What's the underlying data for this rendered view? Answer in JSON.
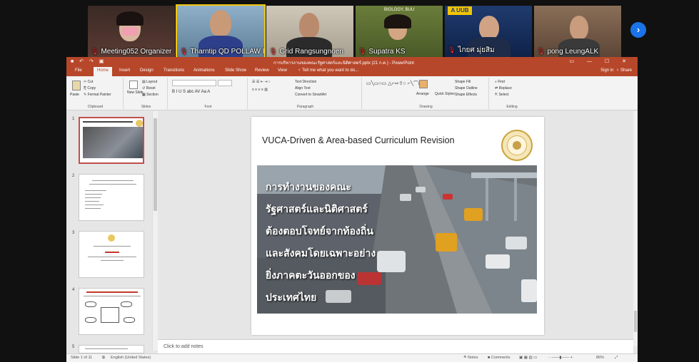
{
  "meeting": {
    "participants": [
      {
        "name": "Meeting052 Organizer",
        "active": false
      },
      {
        "name": "Tharntip QD POLLAW BUU",
        "active": true
      },
      {
        "name": "Grid Rangsungnoen",
        "active": false
      },
      {
        "name": "Supatra KS",
        "active": false
      },
      {
        "name": "ไกยศ มุ่ยสิม",
        "active": false
      },
      {
        "name": "pong LeungALK",
        "active": false
      }
    ],
    "next_icon": "chevron-right-icon"
  },
  "ppt": {
    "title": "การบริหารงานของคณะรัฐศาสตร์และนิติศาสตร์.pptx (21 ก.ค.) - PowerPoint",
    "tabs": [
      "File",
      "Home",
      "Insert",
      "Design",
      "Transitions",
      "Animations",
      "Slide Show",
      "Review",
      "View",
      "Tell me what you want to do..."
    ],
    "active_tab": "Home",
    "sign_in": "Sign in",
    "share": "Share",
    "ribbon": {
      "clipboard": {
        "label": "Clipboard",
        "paste": "Paste",
        "cut": "Cut",
        "copy": "Copy",
        "format_painter": "Format Painter"
      },
      "slides": {
        "label": "Slides",
        "new_slide": "New Slide",
        "layout": "Layout",
        "reset": "Reset",
        "section": "Section"
      },
      "font": {
        "label": "Font"
      },
      "paragraph": {
        "label": "Paragraph",
        "text_direction": "Text Direction",
        "align_text": "Align Text",
        "convert": "Convert to SmartArt"
      },
      "drawing": {
        "label": "Drawing",
        "arrange": "Arrange",
        "quick_styles": "Quick Styles",
        "shape_fill": "Shape Fill",
        "shape_outline": "Shape Outline",
        "shape_effects": "Shape Effects"
      },
      "editing": {
        "label": "Editing",
        "find": "Find",
        "replace": "Replace",
        "select": "Select"
      }
    },
    "thumb_numbers": [
      "1",
      "2",
      "3",
      "4",
      "5"
    ],
    "slide": {
      "title": "VUCA-Driven & Area-based Curriculum Revision",
      "lines": [
        "การทำงานของคณะ",
        "รัฐศาสตร์และนิติศาสตร์",
        "ต้องตอบโจทย์จากท้องถิ่น",
        "และสังคมโดยเฉพาะอย่าง",
        "ยิ่งภาคตะวันออกของ",
        "ประเทศไทย"
      ]
    },
    "notes_placeholder": "Click to add notes",
    "status": {
      "slide_count": "Slide 1 of 11",
      "language": "English (United States)",
      "notes": "Notes",
      "comments": "Comments",
      "zoom": "86%"
    }
  }
}
